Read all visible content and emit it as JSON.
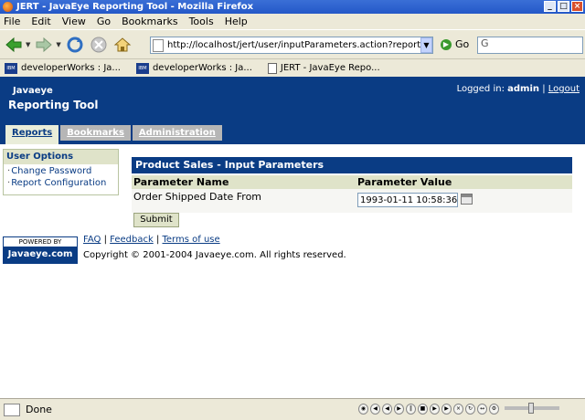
{
  "window": {
    "title": "JERT - JavaEye Reporting Tool - Mozilla Firefox"
  },
  "menu": [
    "File",
    "Edit",
    "View",
    "Go",
    "Bookmarks",
    "Tools",
    "Help"
  ],
  "toolbar": {
    "url": "http://localhost/jert/user/inputParameters.action?reportDefinit",
    "go_label": "Go",
    "search_value": "G"
  },
  "bookmarks": [
    "developerWorks : Ja...",
    "developerWorks : Ja...",
    "JERT - JavaEye Repo..."
  ],
  "bookmark_icon_text": "IBM",
  "header": {
    "brand_small": "Javaeye",
    "brand_big": "Reporting Tool",
    "logged_in_label": "Logged in:",
    "user": "admin",
    "separator": "|",
    "logout": "Logout"
  },
  "tabs": [
    {
      "label": "Reports",
      "active": true
    },
    {
      "label": "Bookmarks",
      "active": false
    },
    {
      "label": "Administration",
      "active": false
    }
  ],
  "sidebar": {
    "title": "User Options",
    "items": [
      "Change Password",
      "Report Configuration"
    ]
  },
  "panel": {
    "title": "Product Sales - Input Parameters",
    "col_name": "Parameter Name",
    "col_value": "Parameter Value",
    "param_label": "Order Shipped Date From",
    "param_value": "1993-01-11 10:58:36",
    "submit_label": "Submit"
  },
  "footer": {
    "powered_by": "POWERED BY",
    "powered_brand": "Javaeye.com",
    "links": [
      "FAQ",
      "Feedback",
      "Terms of use"
    ],
    "sep": "|",
    "copyright": "Copyright © 2001-2004 Javaeye.com. All rights reserved."
  },
  "status": {
    "text": "Done"
  },
  "colors": {
    "brand_blue": "#0a3c84",
    "accent_green": "#dfe3c9"
  }
}
